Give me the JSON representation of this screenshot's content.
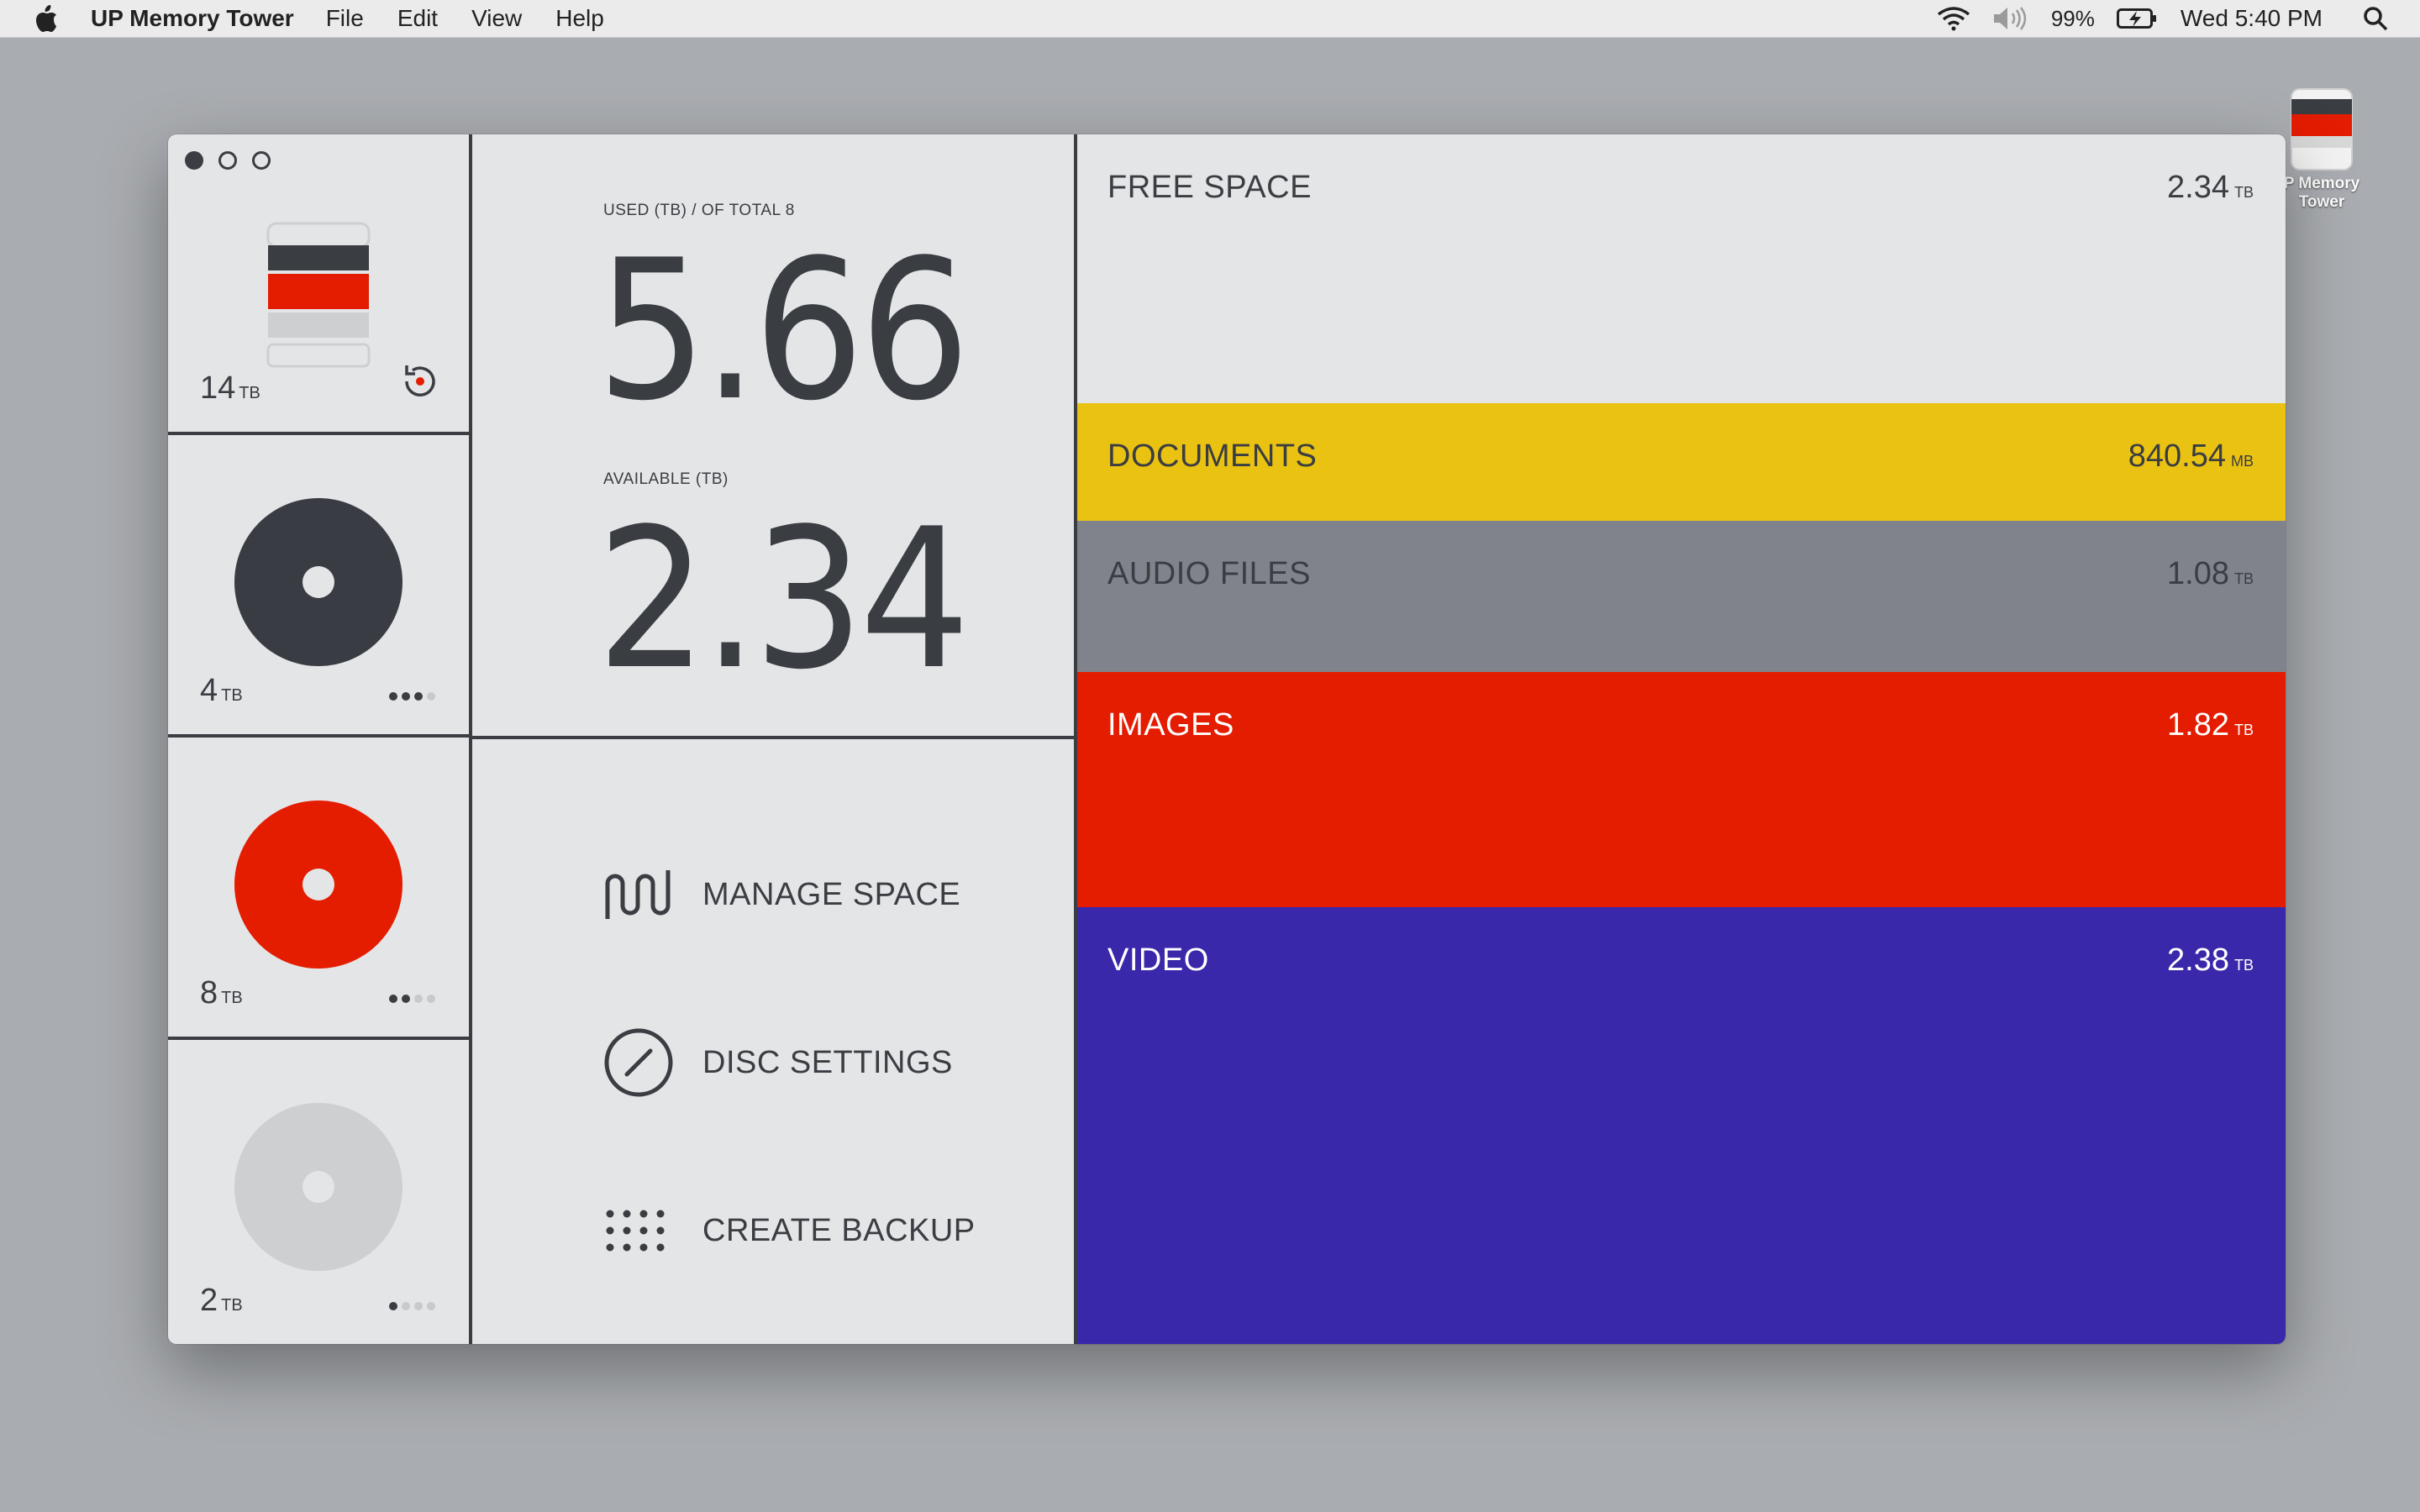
{
  "menubar": {
    "app_name": "UP Memory Tower",
    "menus": [
      "File",
      "Edit",
      "View",
      "Help"
    ],
    "battery": "99%",
    "clock": "Wed 5:40 PM"
  },
  "desktop_icon": {
    "label_line1": "P Memory",
    "label_line2": "Tower"
  },
  "disks": [
    {
      "size": "14",
      "unit": "TB",
      "type": "tower",
      "dots_on": 0,
      "dots_total": 0,
      "action_icon": "refresh-icon"
    },
    {
      "size": "4",
      "unit": "TB",
      "type": "disc",
      "color": "#393c42",
      "dots_on": 3,
      "dots_total": 4
    },
    {
      "size": "8",
      "unit": "TB",
      "type": "disc",
      "color": "#e41c00",
      "dots_on": 2,
      "dots_total": 4
    },
    {
      "size": "2",
      "unit": "TB",
      "type": "disc",
      "color": "#cdcfd1",
      "dots_on": 1,
      "dots_total": 4
    }
  ],
  "summary": {
    "used_caption": "USED (TB) / OF TOTAL 8",
    "used_value": "5.66",
    "available_caption": "AVAILABLE (TB)",
    "available_value": "2.34"
  },
  "actions": [
    {
      "label": "MANAGE SPACE",
      "icon": "wave-icon"
    },
    {
      "label": "DISC SETTINGS",
      "icon": "gauge-icon"
    },
    {
      "label": "CREATE BACKUP",
      "icon": "dot-grid-icon"
    }
  ],
  "categories": [
    {
      "name": "FREE SPACE",
      "value": "2.34",
      "unit": "TB",
      "bg": "#e4e5e7",
      "fg": "#3a3d42"
    },
    {
      "name": "DOCUMENTS",
      "value": "840.54",
      "unit": "MB",
      "bg": "#eac212",
      "fg": "#3a3d42"
    },
    {
      "name": "AUDIO FILES",
      "value": "1.08",
      "unit": "TB",
      "bg": "#80838b",
      "fg": "#3a3d42"
    },
    {
      "name": "IMAGES",
      "value": "1.82",
      "unit": "TB",
      "bg": "#e41c00",
      "fg": "#ffffff"
    },
    {
      "name": "VIDEO",
      "value": "2.38",
      "unit": "TB",
      "bg": "#3a28aa",
      "fg": "#ffffff"
    }
  ],
  "colors": {
    "ink": "#3a3d42",
    "panel": "#e4e5e7",
    "red": "#e41c00",
    "light_gray": "#cdcfd1"
  }
}
